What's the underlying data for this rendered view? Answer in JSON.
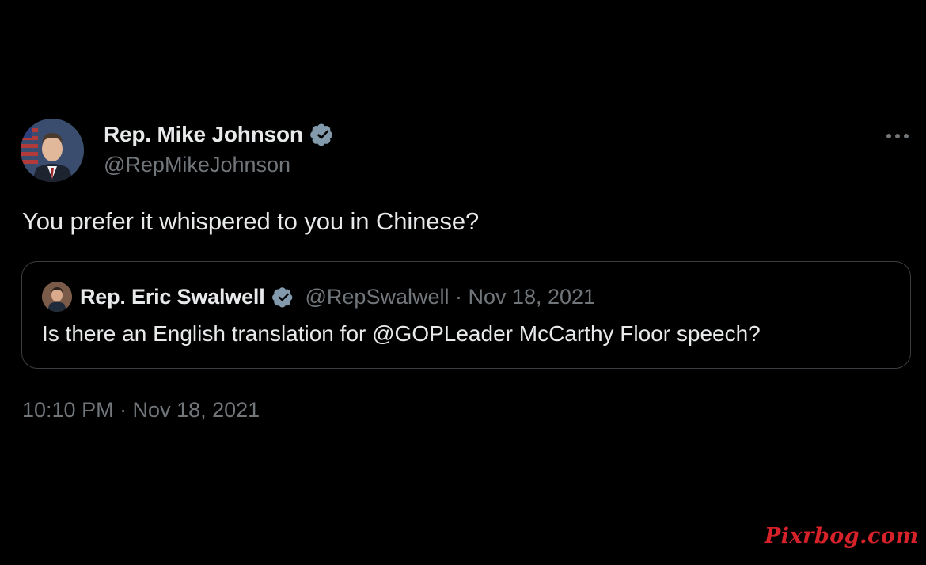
{
  "tweet": {
    "author": {
      "name": "Rep. Mike Johnson",
      "handle": "@RepMikeJohnson",
      "verified": true
    },
    "text": "You prefer it whispered to you in Chinese?",
    "timestamp": "10:10 PM · Nov 18, 2021",
    "more_icon": "more-horizontal-icon"
  },
  "quoted_tweet": {
    "author": {
      "name": "Rep. Eric Swalwell",
      "handle": "@RepSwalwell",
      "verified": true
    },
    "meta": "@RepSwalwell · Nov 18, 2021",
    "text": "Is there an English translation for @GOPLeader McCarthy Floor speech?"
  },
  "watermark": "Pixrbog.com",
  "colors": {
    "background": "#000000",
    "primary_text": "#e7e9ea",
    "secondary_text": "#71767b",
    "verified_badge": "#829aab",
    "border": "#3a3e42",
    "watermark": "#d8222a"
  }
}
